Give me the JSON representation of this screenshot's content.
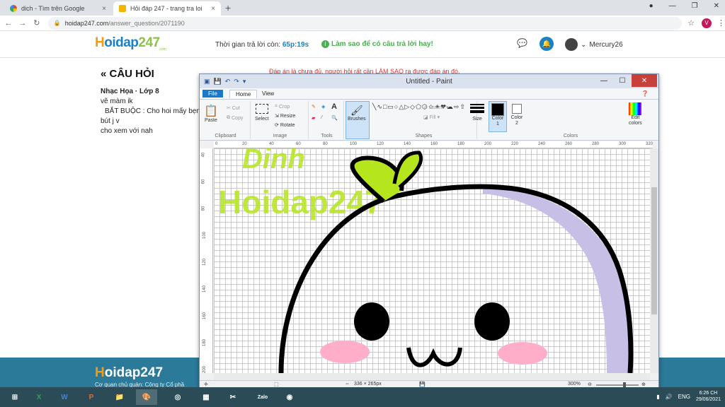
{
  "browser": {
    "tabs": [
      {
        "title": "dich - Tìm trên Google",
        "close": "×"
      },
      {
        "title": "Hỏi đáp 247 - trang tra loi",
        "close": "×"
      }
    ],
    "new_tab": "+",
    "url_host": "hoidap247.com",
    "url_path": "/answer_question/2071190",
    "profile_initial": "V"
  },
  "header": {
    "logo_h": "H",
    "logo_main": "oidap",
    "logo_num": "247",
    "logo_sub": ".com",
    "timer_label": "Thời gian trả lời còn:",
    "timer_value": "65p:19s",
    "tips_icon": "i",
    "tips": "Làm sao để có câu trả lời hay!",
    "username": "Mercury26"
  },
  "question": {
    "heading": "« CÂU HỎI",
    "subject": "Nhạc Họa · Lớp 8",
    "lines": [
      "vẽ màm ik",
      "BẮT BUỘC : Cho hoi mấy bẹn",
      "bút j v",
      "cho xem với nah"
    ],
    "warning": "Đáp án là chưa đủ, người hỏi rất cần LÀM SAO ra được đáp án đó."
  },
  "footer": {
    "logo_h": "H",
    "logo_main": "oidap247",
    "logo_sub": ".com",
    "text": "Cơ quan chủ quản: Công ty Cổ phầ"
  },
  "paint": {
    "title": "Untitled - Paint",
    "menu_file": "File",
    "menu_home": "Home",
    "menu_view": "View",
    "clipboard": {
      "paste": "Paste",
      "cut": "Cut",
      "copy": "Copy",
      "label": "Clipboard"
    },
    "image": {
      "crop": "Crop",
      "resize": "Resize",
      "select": "Select",
      "rotate": "Rotate",
      "label": "Image"
    },
    "tools_label": "Tools",
    "brushes": "Brushes",
    "shapes": {
      "outline": "Outline",
      "fill": "Fill",
      "label": "Shapes"
    },
    "size": "Size",
    "color1": "Color\n1",
    "color2": "Color\n2",
    "colors_label": "Colors",
    "edit_colors": "Edit\ncolors",
    "ruler_h": [
      "0",
      "20",
      "40",
      "60",
      "80",
      "100",
      "120",
      "140",
      "160",
      "180",
      "200",
      "220",
      "240",
      "260",
      "280",
      "300",
      "320"
    ],
    "ruler_v": [
      "40",
      "60",
      "80",
      "100",
      "120",
      "140",
      "160",
      "180",
      "200"
    ],
    "canvas_text_top": "Dinh",
    "canvas_text": "Hoidap247",
    "status_size": "336 × 265px",
    "zoom": "300%",
    "palette": [
      "#000000",
      "#7f7f7f",
      "#880015",
      "#ed1c24",
      "#ff7f27",
      "#fff200",
      "#22b14c",
      "#00a2e8",
      "#3f48cc",
      "#a349a4",
      "#ffffff",
      "#c3c3c3",
      "#b97a57",
      "#ffaec9",
      "#ffc90e",
      "#efe4b0",
      "#b5e61d",
      "#99d9ea",
      "#7092be",
      "#c8bfe7",
      "#ffffff",
      "#ffffff",
      "#ffffff",
      "#ffffff",
      "#ffffff",
      "#ffffff",
      "#ffffff",
      "#ffffff",
      "#ffffff",
      "#ffffff"
    ],
    "colors": {
      "outline": "#000000",
      "purple": "#c8bfe7",
      "green": "#b5e61d",
      "pink": "#ffaec9"
    }
  },
  "taskbar": {
    "apps": [
      "X",
      "W",
      "P",
      "",
      "",
      "",
      "",
      "",
      "Zalo",
      ""
    ],
    "lang": "ENG",
    "time": "6:26 CH",
    "date": "29/06/2021"
  }
}
